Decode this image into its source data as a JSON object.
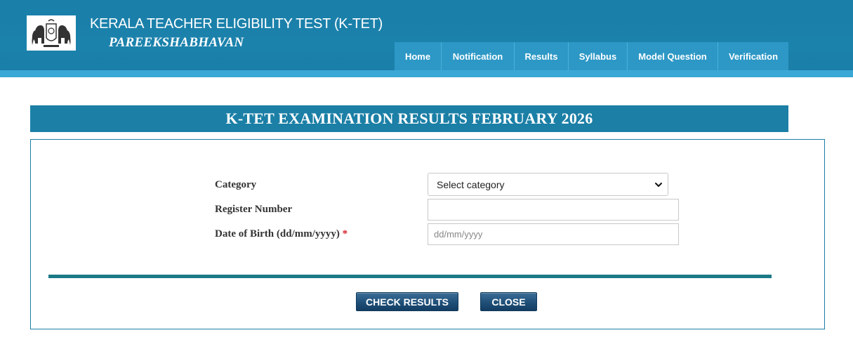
{
  "header": {
    "title": "KERALA TEACHER ELIGIBILITY TEST (K-TET)",
    "subtitle": "PAREEKSHABHAVAN",
    "emblem_icon": "kerala-emblem-icon",
    "nav": [
      {
        "label": "Home"
      },
      {
        "label": "Notification"
      },
      {
        "label": "Results"
      },
      {
        "label": "Syllabus"
      },
      {
        "label": "Model Question"
      },
      {
        "label": "Verification"
      }
    ]
  },
  "banner": {
    "title": "K-TET EXAMINATION RESULTS FEBRUARY 2026"
  },
  "form": {
    "category": {
      "label": "Category",
      "selected": "Select category"
    },
    "register_number": {
      "label": "Register Number",
      "value": ""
    },
    "dob": {
      "label": "Date of Birth (dd/mm/yyyy)",
      "required_mark": "*",
      "placeholder": "dd/mm/yyyy",
      "value": ""
    },
    "check_button": "CHECK RESULTS",
    "close_button": "CLOSE"
  },
  "colors": {
    "header_bg": "#1a7fa9",
    "header_stripe": "#3aa8d6",
    "nav_bg": "#2d98c6",
    "banner_bg": "#1b7fa6",
    "divider": "#1b7a86",
    "button_bg": "#1f4f78",
    "required": "#d9232d"
  }
}
